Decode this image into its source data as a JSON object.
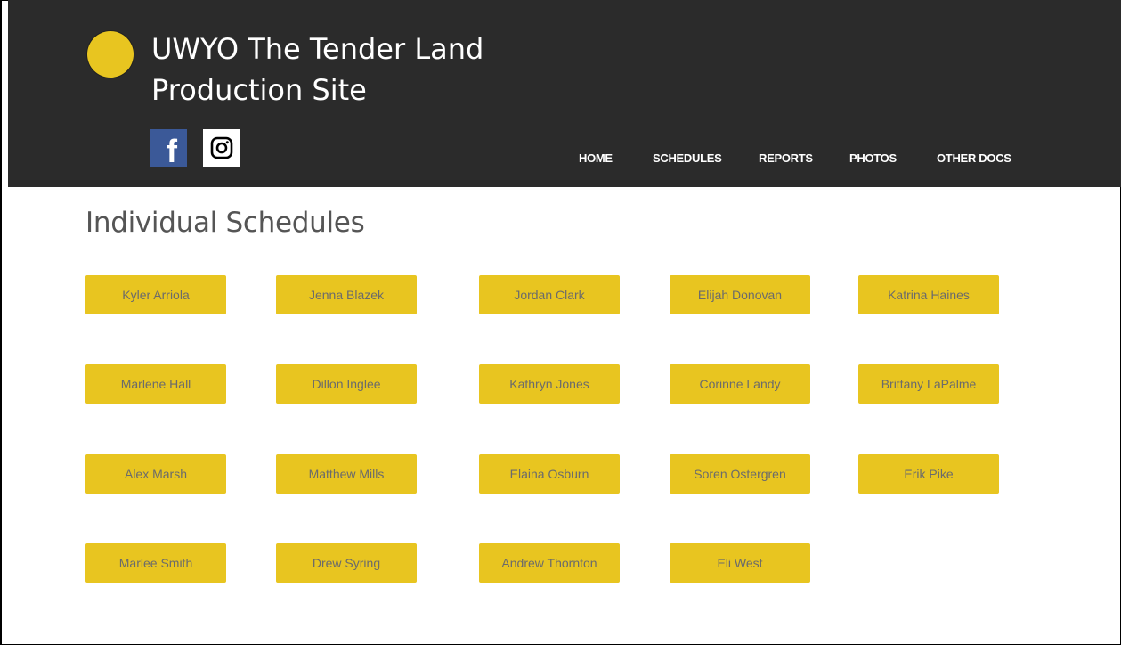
{
  "site": {
    "title": "UWYO The Tender Land Production Site"
  },
  "social": [
    {
      "name": "facebook-icon",
      "glyph": "f"
    },
    {
      "name": "instagram-icon"
    }
  ],
  "nav": [
    {
      "label": "HOME"
    },
    {
      "label": "SCHEDULES"
    },
    {
      "label": "REPORTS"
    },
    {
      "label": "PHOTOS"
    },
    {
      "label": "OTHER DOCS"
    }
  ],
  "page": {
    "heading": "Individual Schedules"
  },
  "people": [
    "Kyler Arriola",
    "Jenna Blazek",
    "Jordan Clark",
    "Elijah Donovan",
    "Katrina Haines",
    "Marlene Hall",
    "Dillon Inglee",
    "Kathryn Jones",
    "Corinne Landy",
    "Brittany LaPalme",
    "Alex Marsh",
    "Matthew Mills",
    "Elaina Osburn",
    "Soren Ostergren",
    "Erik Pike",
    "Marlee Smith",
    "Drew Syring",
    "Andrew Thornton",
    "Eli West"
  ],
  "colors": {
    "header_bg": "#2b2b2b",
    "accent": "#e8c520",
    "facebook": "#3b5998"
  }
}
